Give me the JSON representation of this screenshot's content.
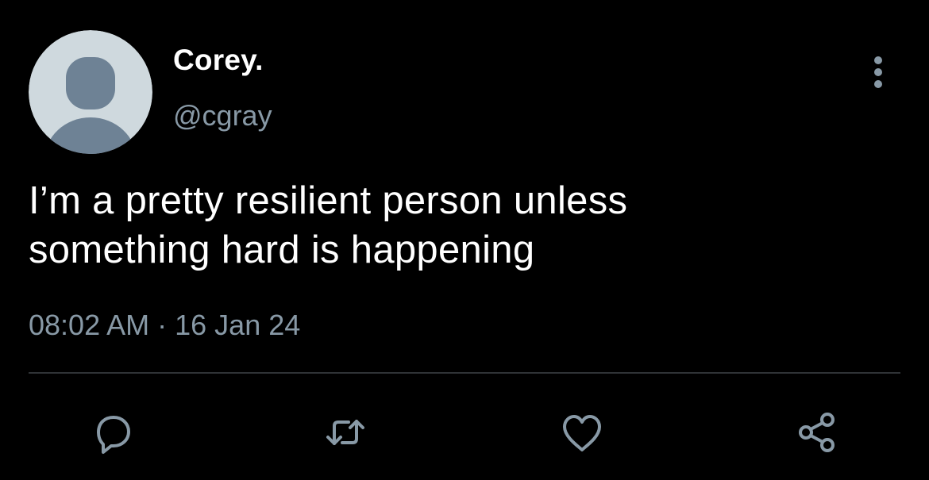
{
  "tweet": {
    "author": {
      "display_name": "Corey.",
      "handle": "@cgray",
      "avatar_icon": "default-avatar-icon"
    },
    "text_lines": [
      "I’m a pretty resilient person unless",
      "something hard is happening"
    ],
    "meta": {
      "time": "08:02 AM",
      "separator": "·",
      "date": "16 Jan 24"
    },
    "menu_icon": "more-vertical-icon",
    "actions": [
      {
        "icon": "reply-icon"
      },
      {
        "icon": "retweet-icon"
      },
      {
        "icon": "like-icon"
      },
      {
        "icon": "share-icon"
      }
    ]
  },
  "colors": {
    "background": "#000000",
    "primary_text": "#ffffff",
    "secondary_text": "#8899a6",
    "divider": "#2f3336",
    "avatar_bg": "#cfd9de",
    "avatar_figure": "#6e8295"
  }
}
